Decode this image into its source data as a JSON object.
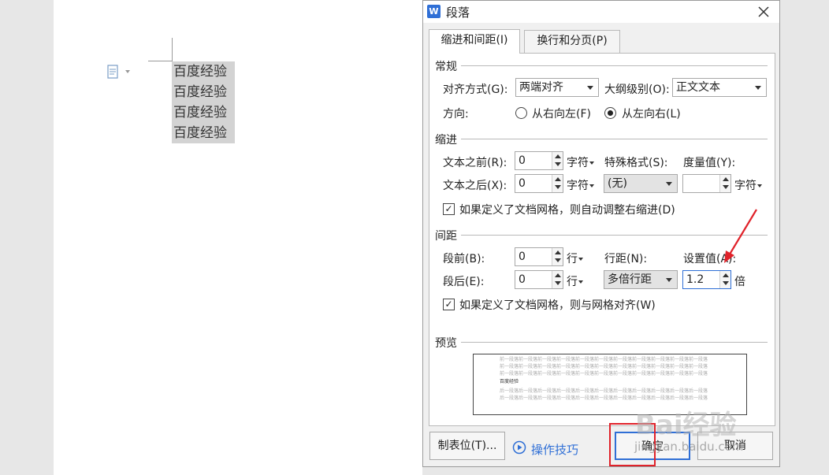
{
  "document": {
    "lines": [
      "百度经验",
      "百度经验",
      "百度经验",
      "百度经验"
    ]
  },
  "dialog": {
    "title": "段落",
    "app_icon_letter": "W",
    "tabs": [
      {
        "label": "缩进和间距(I)",
        "active": true
      },
      {
        "label": "换行和分页(P)",
        "active": false
      }
    ],
    "general": {
      "heading": "常规",
      "align_label": "对齐方式(G):",
      "align_value": "两端对齐",
      "outline_label": "大纲级别(O):",
      "outline_value": "正文文本",
      "direction_label": "方向:",
      "rtl_label": "从右向左(F)",
      "ltr_label": "从左向右(L)",
      "direction_selected": "ltr"
    },
    "indent": {
      "heading": "缩进",
      "before_label": "文本之前(R):",
      "before_value": "0",
      "before_unit": "字符",
      "after_label": "文本之后(X):",
      "after_value": "0",
      "after_unit": "字符",
      "special_label": "特殊格式(S):",
      "special_value": "(无)",
      "measure_label": "度量值(Y):",
      "measure_value": "",
      "measure_unit": "字符",
      "grid_check_label": "如果定义了文档网格，则自动调整右缩进(D)",
      "grid_checked": true
    },
    "spacing": {
      "heading": "间距",
      "before_label": "段前(B):",
      "before_value": "0",
      "before_unit": "行",
      "after_label": "段后(E):",
      "after_value": "0",
      "after_unit": "行",
      "line_label": "行距(N):",
      "line_value": "多倍行距",
      "set_label": "设置值(A):",
      "set_value": "1.2",
      "set_unit": "倍",
      "grid_check_label": "如果定义了文档网格，则与网格对齐(W)",
      "grid_checked": true
    },
    "preview": {
      "heading": "预览",
      "prev_text": "前一段落前一段落前一段落前一段落前一段落前一段落前一段落前一段落前一段落前一段落前一段落",
      "sample_text": "百度经验",
      "next_text": "后一段落后一段落后一段落后一段落后一段落后一段落后一段落后一段落后一段落后一段落后一段落"
    },
    "buttons": {
      "tabs": "制表位(T)...",
      "tips": "操作技巧",
      "ok": "确定",
      "cancel": "取消"
    }
  },
  "watermark": {
    "brand": "Bai经验",
    "url": "jingyan.baidu.com"
  },
  "colors": {
    "accent": "#2f6fd6",
    "annotation_red": "#e0222a",
    "selection": "#d3d3d3"
  }
}
